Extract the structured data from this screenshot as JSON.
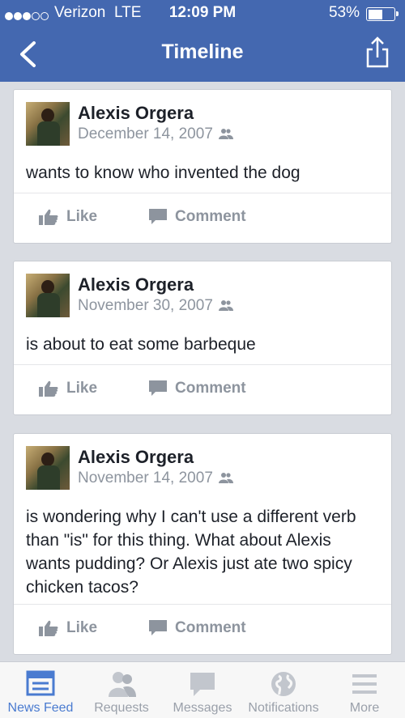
{
  "status_bar": {
    "carrier": "Verizon",
    "network": "LTE",
    "time": "12:09 PM",
    "battery": "53%"
  },
  "nav": {
    "title": "Timeline",
    "back_icon": "chevron-left-icon",
    "share_icon": "share-icon"
  },
  "posts": [
    {
      "name": "Alexis Orgera",
      "date": "December 14, 2007",
      "text": "wants to know who invented the dog",
      "like": "Like",
      "comment": "Comment"
    },
    {
      "name": "Alexis Orgera",
      "date": "November 30, 2007",
      "text": "is about to eat some barbeque",
      "like": "Like",
      "comment": "Comment"
    },
    {
      "name": "Alexis Orgera",
      "date": "November 14, 2007",
      "text": "is wondering why I can't use a different verb than \"is\" for this thing. What about Alexis wants pudding? Or Alexis just ate two spicy chicken tacos?",
      "like": "Like",
      "comment": "Comment"
    }
  ],
  "tabbar": {
    "tabs": [
      {
        "label": "News Feed",
        "icon": "news-feed-icon",
        "active": true
      },
      {
        "label": "Requests",
        "icon": "friends-icon",
        "active": false
      },
      {
        "label": "Messages",
        "icon": "messages-icon",
        "active": false
      },
      {
        "label": "Notifications",
        "icon": "globe-icon",
        "active": false
      },
      {
        "label": "More",
        "icon": "menu-icon",
        "active": false
      }
    ]
  },
  "colors": {
    "header": "#4468b0",
    "background": "#d9dce2",
    "active_tab": "#4a7bd0",
    "muted": "#8d949e"
  }
}
